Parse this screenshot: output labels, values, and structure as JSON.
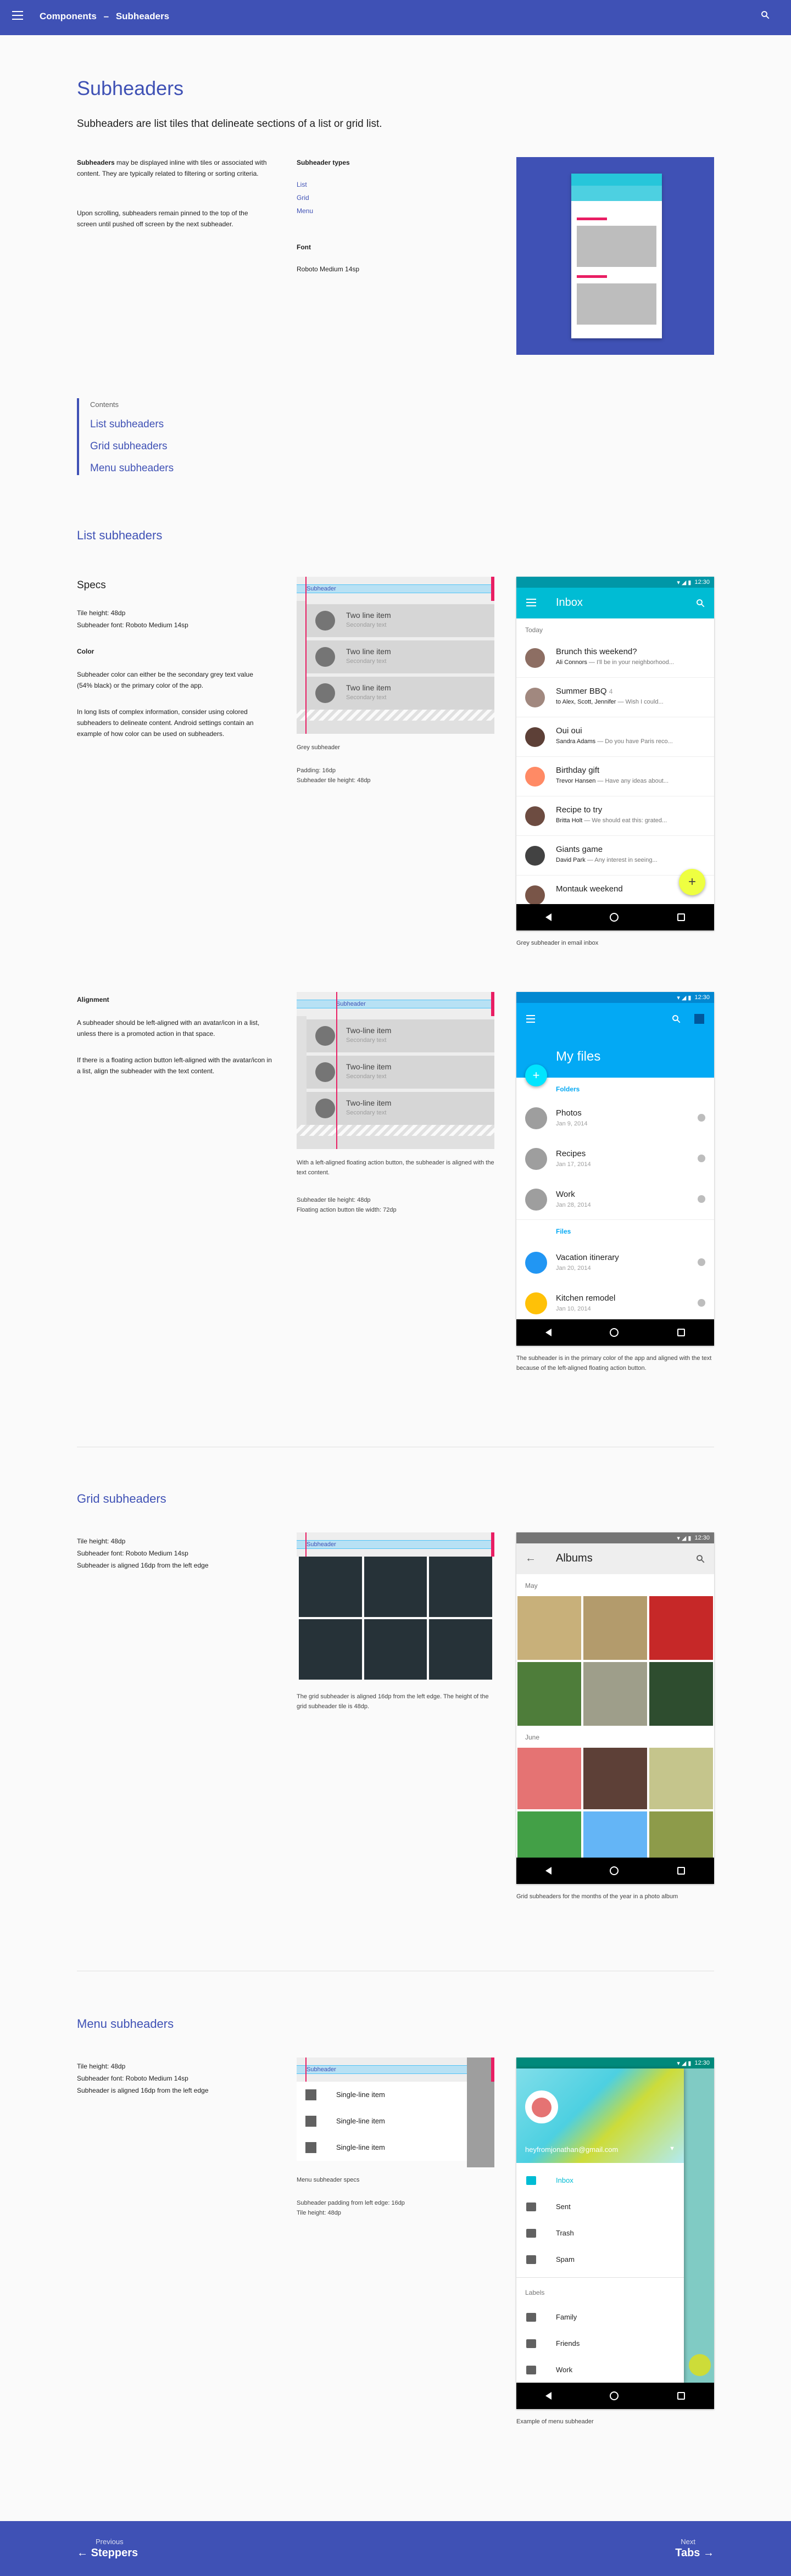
{
  "appbar": {
    "section": "Components",
    "sep": "–",
    "page": "Subheaders"
  },
  "intro": {
    "title": "Subheaders",
    "lede": "Subheaders are list tiles that delineate sections of a list or grid list.",
    "p1_bold": "Subheaders",
    "p1_rest": " may be displayed inline with tiles or associated with content. They are typically related to filtering or sorting criteria.",
    "p2": "Upon scrolling, subheaders remain pinned to the top of the screen until pushed off screen by the next subheader.",
    "types_heading": "Subheader types",
    "types": [
      "List",
      "Grid",
      "Menu"
    ],
    "font_heading": "Font",
    "font_value": "Roboto Medium 14sp"
  },
  "contents": {
    "title": "Contents",
    "items": [
      "List subheaders",
      "Grid subheaders",
      "Menu subheaders"
    ]
  },
  "list": {
    "heading": "List subheaders",
    "specs_title": "Specs",
    "spec1": "Tile height: 48dp",
    "spec2": "Subheader font: Roboto Medium 14sp",
    "color_heading": "Color",
    "color_p1": "Subheader color can either be the secondary grey text value (54% black) or the primary color of the app.",
    "color_p2": "In long lists of complex information, consider using colored subheaders to delineate content. Android settings contain an example of how color can be used on subheaders.",
    "diagram_sub": "Subheader",
    "item_primary": "Two line item",
    "item_secondary": "Secondary text",
    "diagram_caption1": "Grey subheader",
    "diagram_caption2": "Padding: 16dp",
    "diagram_caption3": "Subheader tile height: 48dp",
    "phone": {
      "time": "12:30",
      "title": "Inbox",
      "section": "Today",
      "rows": [
        {
          "subject": "Brunch this weekend?",
          "from": "Ali Connors",
          "snippet": " — I'll be in your neighborhood...",
          "color": "#8d6e63"
        },
        {
          "subject": "Summer BBQ",
          "count": "4",
          "from": "to Alex, Scott, Jennifer",
          "snippet": " — Wish I could...",
          "color": "#a1887f"
        },
        {
          "subject": "Oui oui",
          "from": "Sandra Adams",
          "snippet": " — Do you have Paris reco...",
          "color": "#5d4037"
        },
        {
          "subject": "Birthday gift",
          "from": "Trevor Hansen",
          "snippet": " — Have any ideas about...",
          "color": "#ff8a65"
        },
        {
          "subject": "Recipe to try",
          "from": "Britta Holt",
          "snippet": " — We should eat this: grated...",
          "color": "#6d4c41"
        },
        {
          "subject": "Giants game",
          "from": "David Park",
          "snippet": " — Any interest in seeing...",
          "color": "#424242"
        },
        {
          "subject": "Montauk weekend",
          "from": "",
          "snippet": "",
          "color": "#795548"
        }
      ],
      "fab": "+"
    },
    "phone_caption": "Grey subheader in email inbox",
    "align_heading": "Alignment",
    "align_p1": "A subheader should be left-aligned with an avatar/icon in a list, unless there is a promoted action in that space.",
    "align_p2": "If there is a floating action button left-aligned with the avatar/icon in a list, align the subheader with the text content.",
    "align_item_primary": "Two-line item",
    "align_caption1": "With a left-aligned floating action button, the subheader is aligned with the text content.",
    "align_caption2": "Subheader tile height: 48dp",
    "align_caption3": "Floating action button tile width: 72dp",
    "files_phone": {
      "time": "12:30",
      "title": "My files",
      "folders": "Folders",
      "folder_rows": [
        {
          "name": "Photos",
          "date": "Jan 9, 2014"
        },
        {
          "name": "Recipes",
          "date": "Jan 17, 2014"
        },
        {
          "name": "Work",
          "date": "Jan 28, 2014"
        }
      ],
      "files": "Files",
      "file_rows": [
        {
          "name": "Vacation itinerary",
          "date": "Jan 20, 2014",
          "color": "#2196f3"
        },
        {
          "name": "Kitchen remodel",
          "date": "Jan 10, 2014",
          "color": "#ffc107"
        }
      ],
      "fab": "+"
    },
    "files_caption": "The subheader is in the primary color of the app and aligned with the text because of the left-aligned floating action button."
  },
  "grid": {
    "heading": "Grid subheaders",
    "spec1": "Tile height: 48dp",
    "spec2": "Subheader font: Roboto Medium 14sp",
    "spec3": "Subheader is aligned 16dp from the left edge",
    "diagram_sub": "Subheader",
    "caption": "The grid subheader is aligned 16dp from the left edge. The height of the grid subheader tile is 48dp.",
    "phone": {
      "time": "12:30",
      "title": "Albums",
      "month1": "May",
      "month2": "June",
      "may_tiles": [
        "#c8b07a",
        "#b39b6c",
        "#c62828",
        "#4e7d3a",
        "#9e9e8a",
        "#2e4d2f"
      ],
      "june_tiles": [
        "#e57373",
        "#5d4037",
        "#c5c58c",
        "#43a047",
        "#64b5f6",
        "#8d9b4a"
      ]
    },
    "phone_caption": "Grid subheaders for the months of the year in a photo album"
  },
  "menu": {
    "heading": "Menu subheaders",
    "spec1": "Tile height: 48dp",
    "spec2": "Subheader font: Roboto Medium 14sp",
    "spec3": "Subheader is aligned 16dp from the left edge",
    "diagram_sub": "Subheader",
    "items": [
      "Single-line item",
      "Single-line item",
      "Single-line item"
    ],
    "caption1": "Menu subheader specs",
    "caption2": "Subheader padding from left edge: 16dp",
    "caption3": "Tile height: 48dp",
    "phone": {
      "time": "12:30",
      "email": "heyfromjonathan@gmail.com",
      "primary": [
        "Inbox",
        "Sent",
        "Trash",
        "Spam"
      ],
      "labels": "Labels",
      "label_items": [
        "Family",
        "Friends",
        "Work"
      ]
    },
    "phone_caption": "Example of menu subheader"
  },
  "footer": {
    "prev_cap": "Previous",
    "prev": "Steppers",
    "next_cap": "Next",
    "next": "Tabs"
  },
  "colors": {
    "primary": "#3f51b5",
    "accent": "#e91e63",
    "cyan": "#00bcd4",
    "blue": "#03a9f4",
    "fab_yellow": "#eeff41"
  }
}
